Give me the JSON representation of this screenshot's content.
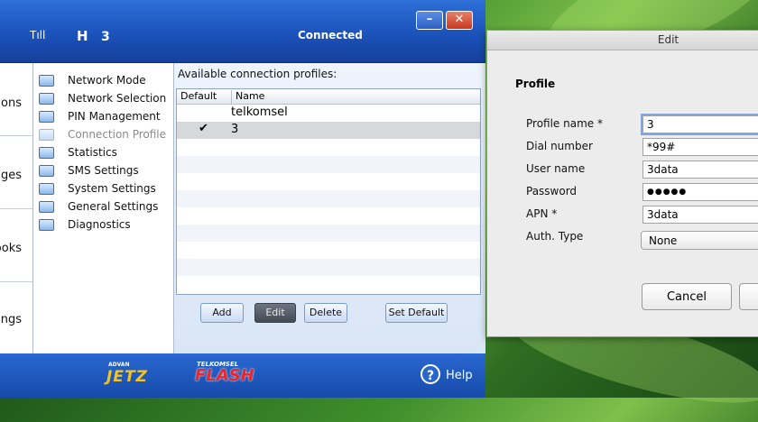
{
  "app": {
    "status": "Connected",
    "network_type": "3",
    "signal_label": "Tıll",
    "hsdpa_label": "H",
    "min_label": "–",
    "close_label": "✕",
    "left_tabs": [
      "ions",
      "ages",
      "ooks",
      "ings"
    ],
    "nav": [
      {
        "label": "Network Mode",
        "disabled": false
      },
      {
        "label": "Network Selection",
        "disabled": false
      },
      {
        "label": "PIN Management",
        "disabled": false
      },
      {
        "label": "Connection Profile",
        "disabled": true
      },
      {
        "label": "Statistics",
        "disabled": false
      },
      {
        "label": "SMS Settings",
        "disabled": false
      },
      {
        "label": "System Settings",
        "disabled": false
      },
      {
        "label": "General Settings",
        "disabled": false
      },
      {
        "label": "Diagnostics",
        "disabled": false
      }
    ],
    "profiles_caption": "Available connection profiles:",
    "columns": [
      "Default",
      "Name"
    ],
    "profiles": [
      {
        "default_mark": "",
        "name": "telkomsel"
      },
      {
        "default_mark": "✔",
        "name": "3"
      }
    ],
    "buttons": {
      "add": "Add",
      "edit": "Edit",
      "delete": "Delete",
      "set_default": "Set Default"
    },
    "footer": {
      "brand_small": "ADVAN",
      "brand": "JETZ",
      "operator_small": "TELKOMSEL",
      "operator": "FLASH",
      "help": "Help",
      "help_icon": "?"
    }
  },
  "dialog": {
    "title": "Edit",
    "section": "Profile",
    "fields": {
      "profile_name": {
        "label": "Profile name *",
        "value": "3"
      },
      "dial_number": {
        "label": "Dial number",
        "value": "*99#"
      },
      "user_name": {
        "label": "User name",
        "value": "3data"
      },
      "password": {
        "label": "Password",
        "value": "●●●●●"
      },
      "apn": {
        "label": "APN *",
        "value": "3data"
      },
      "auth_type": {
        "label": "Auth. Type",
        "value": "None"
      }
    },
    "cancel": "Cancel"
  },
  "colors": {
    "titlebar": "#1a50b8",
    "accent_red": "#e8262d",
    "brand_yellow": "#f3c321"
  }
}
